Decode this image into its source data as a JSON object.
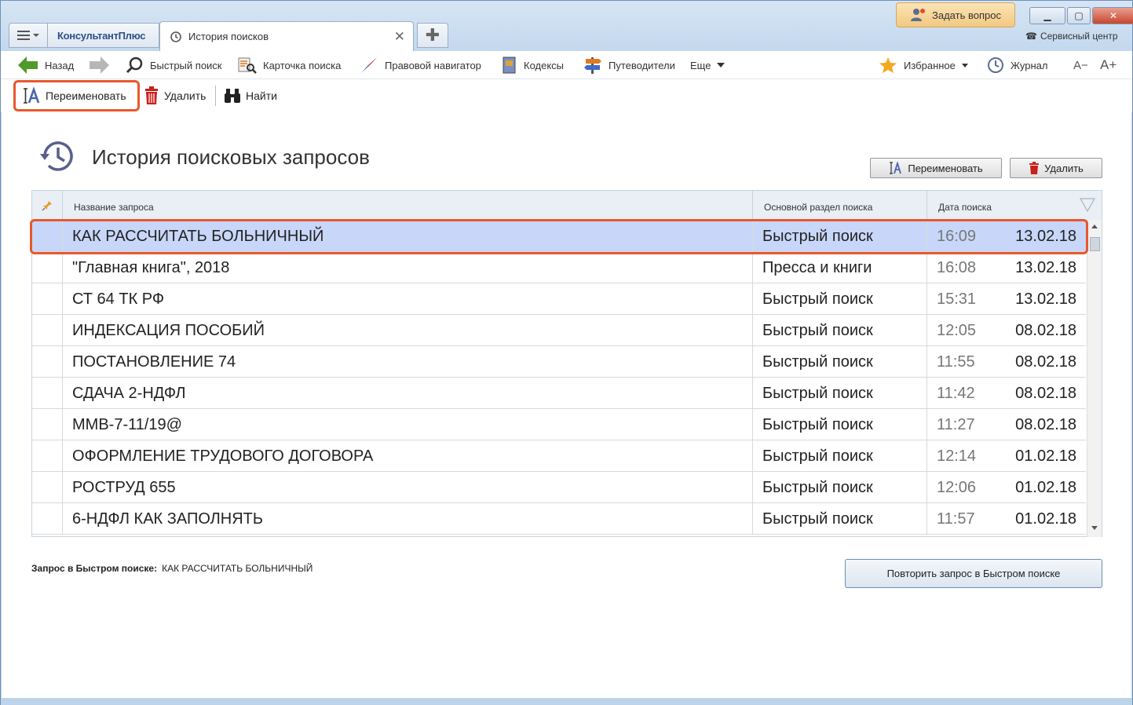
{
  "titlebar": {
    "brand": "КонсультантПлюс",
    "tab_title": "История поисков",
    "tab_close": "✕",
    "ask_button": "Задать вопрос",
    "service_center": "Сервисный центр"
  },
  "toolbar": {
    "back": "Назад",
    "quick_search": "Быстрый поиск",
    "search_card": "Карточка поиска",
    "legal_navigator": "Правовой навигатор",
    "codes": "Кодексы",
    "guides": "Путеводители",
    "more": "Еще",
    "favorites": "Избранное",
    "journal": "Журнал",
    "font_smaller": "A−",
    "font_larger": "A+"
  },
  "actions": {
    "rename": "Переименовать",
    "delete": "Удалить",
    "find": "Найти"
  },
  "page": {
    "title": "История поисковых запросов",
    "rename_button": "Переименовать",
    "delete_button": "Удалить"
  },
  "table": {
    "columns": {
      "name": "Название запроса",
      "section": "Основной раздел поиска",
      "date": "Дата поиска"
    },
    "rows": [
      {
        "name": "КАК РАССЧИТАТЬ БОЛЬНИЧНЫЙ",
        "section": "Быстрый поиск",
        "time": "16:09",
        "date": "13.02.18"
      },
      {
        "name": "\"Главная книга\", 2018",
        "section": "Пресса и книги",
        "time": "16:08",
        "date": "13.02.18"
      },
      {
        "name": "СТ 64 ТК РФ",
        "section": "Быстрый поиск",
        "time": "15:31",
        "date": "13.02.18"
      },
      {
        "name": "ИНДЕКСАЦИЯ ПОСОБИЙ",
        "section": "Быстрый поиск",
        "time": "12:05",
        "date": "08.02.18"
      },
      {
        "name": "ПОСТАНОВЛЕНИЕ 74",
        "section": "Быстрый поиск",
        "time": "11:55",
        "date": "08.02.18"
      },
      {
        "name": "СДАЧА 2-НДФЛ",
        "section": "Быстрый поиск",
        "time": "11:42",
        "date": "08.02.18"
      },
      {
        "name": "ММВ-7-11/19@",
        "section": "Быстрый поиск",
        "time": "11:27",
        "date": "08.02.18"
      },
      {
        "name": "ОФОРМЛЕНИЕ ТРУДОВОГО ДОГОВОРА",
        "section": "Быстрый поиск",
        "time": "12:14",
        "date": "01.02.18"
      },
      {
        "name": "РОСТРУД 655",
        "section": "Быстрый поиск",
        "time": "12:06",
        "date": "01.02.18"
      },
      {
        "name": "6-НДФЛ КАК ЗАПОЛНЯТЬ",
        "section": "Быстрый поиск",
        "time": "11:57",
        "date": "01.02.18"
      }
    ]
  },
  "footer": {
    "query_label": "Запрос в Быстром поиске:",
    "query_value": "КАК РАССЧИТАТЬ БОЛЬНИЧНЫЙ",
    "repeat_button": "Повторить запрос в Быстром поиске"
  },
  "colors": {
    "highlight": "#e8582c",
    "selected_row": "#c8d7f9"
  }
}
